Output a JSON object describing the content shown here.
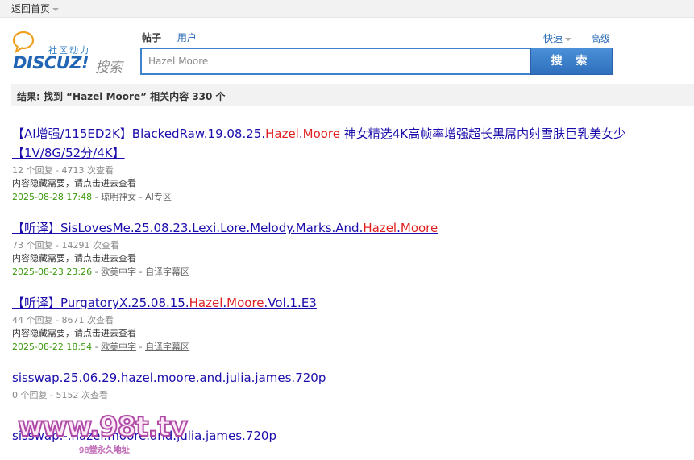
{
  "topbar": {
    "home_label": "返回首页"
  },
  "logo": {
    "tagline": "社区动力",
    "brand": "DISCUZ!",
    "suffix": "搜索"
  },
  "tabs": {
    "posts": "帖子",
    "users": "用户"
  },
  "links": {
    "quick": "快速",
    "advanced": "高级"
  },
  "search": {
    "value": "Hazel Moore",
    "button_label": "搜 索"
  },
  "result_summary": "结果: 找到 “Hazel Moore” 相关内容 330 个",
  "results": [
    {
      "title_pre": "【AI增强/115ED2K】BlackedRaw.19.08.25.",
      "hl1": "Hazel",
      "mid": ".",
      "hl2": "Moore",
      "title_post": " 神女精选4K高帧率增强超长黑屌内射雪肤巨乳美女少【1V/8G/52分/4K】",
      "meta": "12 个回复 - 4713 次查看",
      "hidden_note": "内容隐藏需要，请点击进去查看",
      "date": "2025-08-28 17:48",
      "forum": "琼明神女",
      "subforum": "AI专区"
    },
    {
      "title_pre": "【听译】SisLovesMe.25.08.23.Lexi.Lore.Melody.Marks.And.",
      "hl1": "Hazel",
      "mid": ".",
      "hl2": "Moore",
      "title_post": "",
      "meta": "73 个回复 - 14291 次查看",
      "hidden_note": "内容隐藏需要，请点击进去查看",
      "date": "2025-08-23 23:26",
      "forum": "欧美中字",
      "subforum": "自译字幕区"
    },
    {
      "title_pre": "【听译】PurgatoryX.25.08.15.",
      "hl1": "Hazel",
      "mid": ".",
      "hl2": "Moore",
      "title_post": ".Vol.1.E3",
      "meta": "44 个回复 - 8671 次查看",
      "hidden_note": "内容隐藏需要，请点击进去查看",
      "date": "2025-08-22 18:54",
      "forum": "欧美中字",
      "subforum": "自译字幕区"
    },
    {
      "title_pre": "sisswap.25.06.29.hazel.moore.and.julia.james.720p",
      "hl1": "",
      "mid": "",
      "hl2": "",
      "title_post": "",
      "meta": "0 个回复 - 5152 次查看",
      "hidden_note": "",
      "date": "",
      "forum": "",
      "subforum": ""
    },
    {
      "title_pre": "sisswap.-.hazel.moore.and.julia.james.720p",
      "hl1": "",
      "mid": "",
      "hl2": "",
      "title_post": "",
      "meta": "",
      "hidden_note": "",
      "date": "",
      "forum": "",
      "subforum": ""
    }
  ],
  "watermark": {
    "main": "www.98t.tv",
    "sub": "98堂永久地址"
  },
  "colors": {
    "accent": "#2265b4",
    "highlight": "#e02020",
    "date": "#3c9a0f",
    "link": "#1a0dab"
  }
}
